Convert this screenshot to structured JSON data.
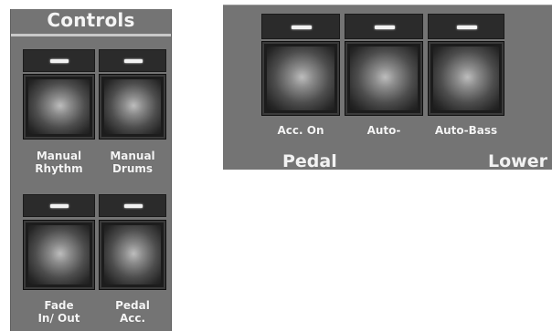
{
  "controls_panel": {
    "title": "Controls",
    "buttons": [
      {
        "label": "Manual\nRhythm"
      },
      {
        "label": "Manual\nDrums"
      },
      {
        "label": "Fade\nIn/ Out"
      },
      {
        "label": "Pedal\nAcc."
      }
    ]
  },
  "accompaniment_panel": {
    "buttons": [
      {
        "label": "Acc. On"
      },
      {
        "label": "Auto-"
      },
      {
        "label": "Auto-Bass"
      }
    ],
    "section_labels": {
      "pedal": "Pedal",
      "lower": "Lower V"
    }
  }
}
